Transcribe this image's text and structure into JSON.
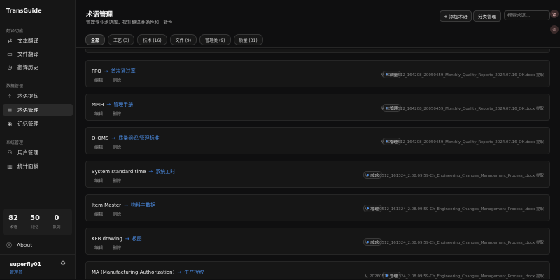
{
  "app": {
    "name": "TransGuide"
  },
  "sidebar": {
    "section1": "翻译功能",
    "section2": "数据管理",
    "section3": "系统管理",
    "items": [
      {
        "label": "文本翻译",
        "icon": "translate-icon"
      },
      {
        "label": "文件翻译",
        "icon": "file-icon"
      },
      {
        "label": "翻译历史",
        "icon": "history-icon"
      },
      {
        "label": "术语提炼",
        "icon": "extract-icon"
      },
      {
        "label": "术语管理",
        "icon": "glossary-icon",
        "active": true
      },
      {
        "label": "记忆管理",
        "icon": "memory-icon"
      },
      {
        "label": "用户管理",
        "icon": "users-icon"
      },
      {
        "label": "统计面板",
        "icon": "chart-icon"
      }
    ],
    "stats": [
      {
        "value": "82",
        "caption": "术语"
      },
      {
        "value": "50",
        "caption": "记忆"
      },
      {
        "value": "0",
        "caption": "队列"
      }
    ],
    "about": "About",
    "user": {
      "name": "superfly01",
      "role": "管理员"
    }
  },
  "header": {
    "title": "术语管理",
    "subtitle": "管理专业术语库，提升翻译准确性和一致性",
    "add_label": "+ 添加术语",
    "category_label": "分类管理",
    "search_placeholder": "搜索术语..."
  },
  "tabs": [
    {
      "label": "全部",
      "active": true
    },
    {
      "label": "工艺 (3)"
    },
    {
      "label": "技术 (16)"
    },
    {
      "label": "文件 (9)"
    },
    {
      "label": "管理类 (9)"
    },
    {
      "label": "质量 (31)"
    }
  ],
  "terms": [
    {
      "source": "FPQ",
      "target": "首次通过率",
      "badge": "质量",
      "file": "从 20260512_164208_20050459_Monthly_Quality_Reports_2024.07.16_OK.docx 提取",
      "edit": "编辑",
      "delete": "删除"
    },
    {
      "source": "MMH",
      "target": "管理手册",
      "badge": "管理",
      "file": "从 20260512_164208_20050459_Monthly_Quality_Reports_2024.07.16_OK.docx 提取",
      "edit": "编辑",
      "delete": "删除"
    },
    {
      "source": "Q-OMS",
      "target": "质量组织/管理标准",
      "badge": "管理",
      "file": "从 20260512_164208_20050459_Monthly_Quality_Reports_2024.07.16_OK.docx 提取",
      "edit": "编辑",
      "delete": "删除"
    },
    {
      "source": "System standard time",
      "target": "系统工时",
      "badge": "技术",
      "file": "从 20260512_161324_2.08.09.59-Ch_Engineering_Changes_Management_Process_.docx 提取",
      "edit": "编辑",
      "delete": "删除"
    },
    {
      "source": "Item Master",
      "target": "物料主数据",
      "badge": "管理",
      "file": "从 20260512_161324_2.08.09.59-Ch_Engineering_Changes_Management_Process_.docx 提取",
      "edit": "编辑",
      "delete": "删除"
    },
    {
      "source": "KFB drawing",
      "target": "板图",
      "badge": "技术",
      "file": "从 20260512_161324_2.08.09.59-Ch_Engineering_Changes_Management_Process_.docx 提取",
      "edit": "编辑",
      "delete": "删除"
    },
    {
      "source": "MA (Manufacturing Authorization)",
      "target": "生产授权",
      "badge": "管理",
      "file": "从 20260512_161324_2.08.09.59-Ch_Engineering_Changes_Management_Process_.docx 提取",
      "edit": "编辑",
      "delete": "删除"
    }
  ],
  "arrow": "→",
  "floating": {
    "top": "译",
    "second": "◎"
  }
}
